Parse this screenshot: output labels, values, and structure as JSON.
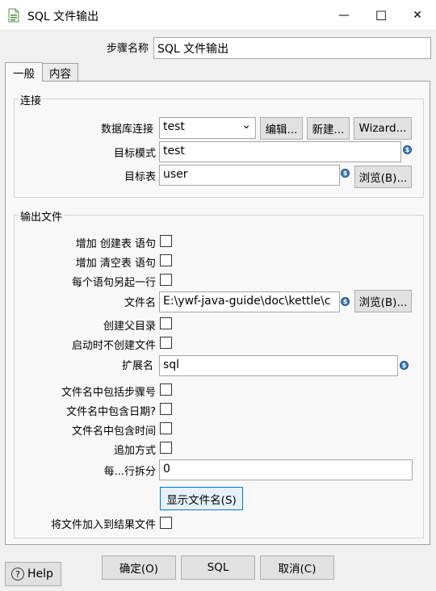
{
  "window": {
    "title": "SQL 文件输出",
    "minimize_glyph": "—",
    "maximize_glyph": "☐",
    "close_glyph": "✕"
  },
  "step_name": {
    "label": "步骤名称",
    "value": "SQL 文件输出"
  },
  "tabs": [
    {
      "label": "一般"
    },
    {
      "label": "内容"
    }
  ],
  "connection": {
    "group_title": "连接",
    "db_label": "数据库连接",
    "db_value": "test",
    "edit_button": "编辑...",
    "new_button": "新建...",
    "wizard_button": "Wizard...",
    "schema_label": "目标模式",
    "schema_value": "test",
    "table_label": "目标表",
    "table_value": "user",
    "browse_button": "浏览(B)..."
  },
  "output": {
    "group_title": "输出文件",
    "add_create_label": "增加 创建表 语句",
    "add_truncate_label": "增加 清空表 语句",
    "new_line_label": "每个语句另起一行",
    "filename_label": "文件名",
    "filename_value": "E:\\ywf-java-guide\\doc\\kettle\\c",
    "browse_button": "浏览(B)...",
    "create_parent_label": "创建父目录",
    "no_create_label": "启动时不创建文件",
    "extension_label": "扩展名",
    "extension_value": "sql",
    "include_stepnr_label": "文件名中包括步骤号",
    "include_date_label": "文件名中包含日期?",
    "include_time_label": "文件名中包含时间",
    "append_label": "追加方式",
    "split_label": "每...行拆分",
    "split_value": "0",
    "show_files_button": "显示文件名(S)",
    "add_to_result_label": "将文件加入到结果文件"
  },
  "footer": {
    "help_label": "Help",
    "ok_button": "确定(O)",
    "sql_button": "SQL",
    "cancel_button": "取消(C)"
  },
  "icons": {
    "variable": "$",
    "help": "?",
    "dropdown": "⌄"
  },
  "colors": {
    "variable_icon": "#3b78b8",
    "window_bg": "#f0f0f0",
    "panel_bg": "#f8f8f8"
  }
}
